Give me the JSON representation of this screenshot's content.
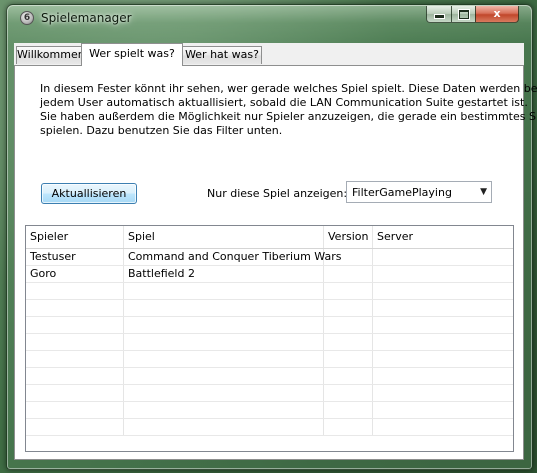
{
  "window": {
    "title": "Spielemanager",
    "icon": "app-icon",
    "buttons": {
      "minimize": "minimize",
      "maximize": "maximize",
      "close": "x"
    }
  },
  "tabs": [
    {
      "label": "Willkommen",
      "active": false
    },
    {
      "label": "Wer spielt was?",
      "active": true
    },
    {
      "label": "Wer hat was?",
      "active": false
    }
  ],
  "main": {
    "description_lines": [
      "In diesem Fester könnt ihr sehen, wer gerade welches Spiel spielt. Diese Daten werden bei",
      "jedem User automatisch aktuallisiert, sobald die LAN Communication Suite gestartet ist.",
      "Sie haben außerdem die Möglichkeit nur Spieler anzuzeigen, die gerade ein bestimmtes Spiel",
      "spielen. Dazu benutzen Sie das Filter unten."
    ],
    "refresh_button": "Aktuallisieren",
    "filter_label": "Nur diese Spiel anzeigen:",
    "filter_value": "FilterGamePlaying"
  },
  "table": {
    "columns": [
      "Spieler",
      "Spiel",
      "Version",
      "Server"
    ],
    "rows": [
      [
        "Testuser",
        "Command and Conquer Tiberium Wars",
        "",
        ""
      ],
      [
        "Goro",
        "Battlefield 2",
        "",
        ""
      ],
      [
        "",
        "",
        "",
        ""
      ],
      [
        "",
        "",
        "",
        ""
      ],
      [
        "",
        "",
        "",
        ""
      ],
      [
        "",
        "",
        "",
        ""
      ],
      [
        "",
        "",
        "",
        ""
      ],
      [
        "",
        "",
        "",
        ""
      ],
      [
        "",
        "",
        "",
        ""
      ],
      [
        "",
        "",
        "",
        ""
      ],
      [
        "",
        "",
        "",
        ""
      ]
    ]
  },
  "colors": {
    "accent": "#3c7fb1",
    "close_button": "#c1472b",
    "window_glass": "#5f8a62"
  }
}
